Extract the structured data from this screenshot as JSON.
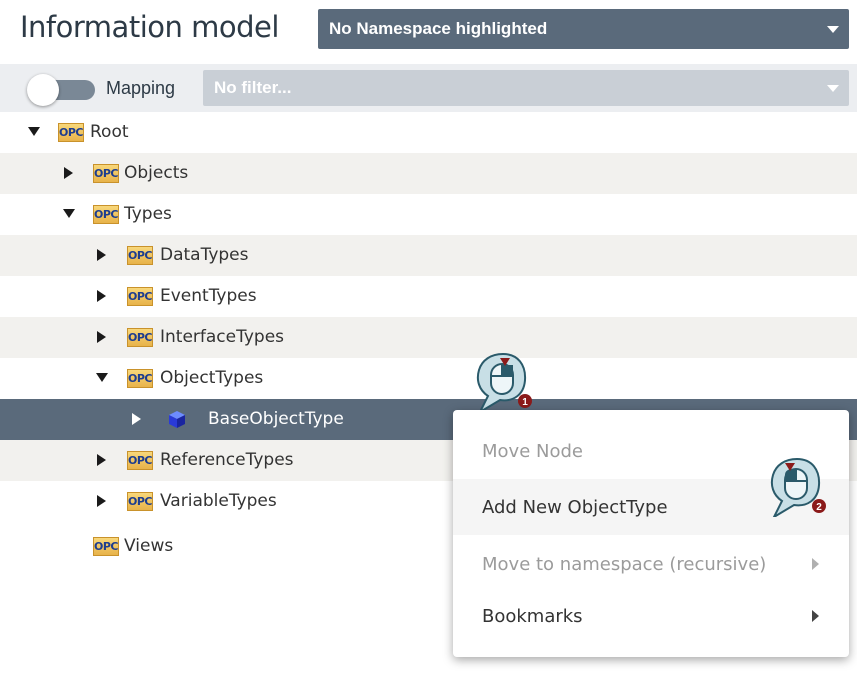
{
  "header": {
    "title": "Information model",
    "namespace_select": "No Namespace highlighted"
  },
  "toolbar": {
    "mapping_label": "Mapping",
    "filter_placeholder": "No filter..."
  },
  "tree": [
    {
      "label": "Root",
      "icon": "opc-folder-icon",
      "expanded": true
    },
    {
      "label": "Objects",
      "icon": "opc-folder-icon",
      "expanded": false
    },
    {
      "label": "Types",
      "icon": "opc-folder-icon",
      "expanded": true
    },
    {
      "label": "DataTypes",
      "icon": "opc-folder-icon",
      "expanded": false
    },
    {
      "label": "EventTypes",
      "icon": "opc-folder-icon",
      "expanded": false
    },
    {
      "label": "InterfaceTypes",
      "icon": "opc-folder-icon",
      "expanded": false
    },
    {
      "label": "ObjectTypes",
      "icon": "opc-folder-icon",
      "expanded": true
    },
    {
      "label": "BaseObjectType",
      "icon": "object-type-cube-icon",
      "expanded": false,
      "selected": true
    },
    {
      "label": "ReferenceTypes",
      "icon": "opc-folder-icon",
      "expanded": false
    },
    {
      "label": "VariableTypes",
      "icon": "opc-folder-icon",
      "expanded": false
    },
    {
      "label": "Views",
      "icon": "opc-folder-icon"
    }
  ],
  "opc_icon_text": "OPC",
  "context_menu": {
    "items": [
      {
        "label": "Move Node",
        "enabled": false
      },
      {
        "label": "Add New ObjectType",
        "enabled": true
      },
      {
        "label": "Move to namespace (recursive)",
        "enabled": false,
        "submenu": true
      },
      {
        "label": "Bookmarks",
        "enabled": true,
        "submenu": true
      }
    ]
  },
  "callouts": [
    {
      "step": "1",
      "icon": "right-click-mouse-icon"
    },
    {
      "step": "2",
      "icon": "left-click-mouse-icon"
    }
  ],
  "colors": {
    "header_select_bg": "#5a6a7b",
    "selected_row_bg": "#5a6a7b",
    "callout_badge": "#8b1a1a",
    "callout_fill": "#c8dfe6"
  }
}
